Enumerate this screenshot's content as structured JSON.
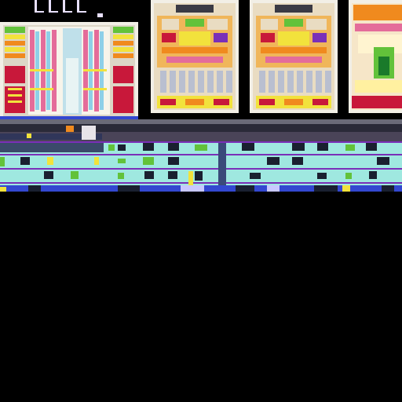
{
  "image": {
    "subject": "die-micrograph",
    "palette": {
      "background": "#000000",
      "die_frame": "#f2efe6",
      "red_block": "#c8183a",
      "orange_block": "#f08a1e",
      "yellow_block": "#f2e23c",
      "green_block": "#62c23a",
      "teal_cells": "#9fe8e0",
      "purple_trace": "#7a2fb8",
      "blue_trace": "#3348d0",
      "gold_pad": "#e8c040",
      "bus_gray": "#4a4458",
      "dark_cell": "#1a2030"
    }
  }
}
